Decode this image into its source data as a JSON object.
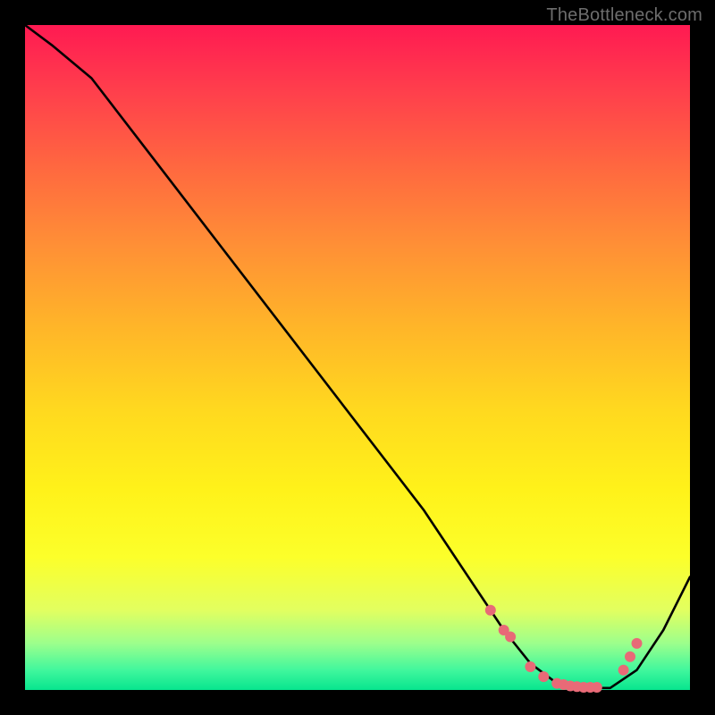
{
  "attribution": "TheBottleneck.com",
  "chart_data": {
    "type": "line",
    "title": "",
    "xlabel": "",
    "ylabel": "",
    "xlim": [
      0,
      100
    ],
    "ylim": [
      0,
      100
    ],
    "gradient_note": "background vertical gradient red→orange→yellow→green maps to y (top=100, bottom=0)",
    "series": [
      {
        "name": "curve",
        "x": [
          0,
          4,
          10,
          20,
          30,
          40,
          50,
          60,
          68,
          72,
          76,
          80,
          84,
          88,
          92,
          96,
          100
        ],
        "y": [
          100,
          97,
          92,
          79,
          66,
          53,
          40,
          27,
          15,
          9,
          4,
          1,
          0.3,
          0.3,
          3,
          9,
          17
        ]
      }
    ],
    "markers": {
      "name": "dots",
      "color": "#e86a77",
      "radius_px": 6,
      "x": [
        70,
        72,
        73,
        76,
        78,
        80,
        81,
        82,
        83,
        84,
        85,
        86,
        90,
        91,
        92
      ],
      "y": [
        12,
        9,
        8,
        3.5,
        2,
        1,
        0.8,
        0.6,
        0.5,
        0.4,
        0.4,
        0.4,
        3,
        5,
        7
      ]
    }
  }
}
